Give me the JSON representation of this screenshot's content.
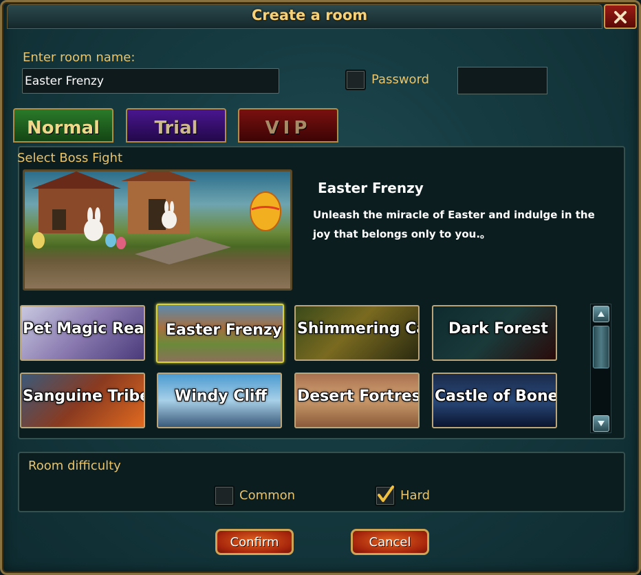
{
  "dialog": {
    "title": "Create a room",
    "close_icon": "close-icon"
  },
  "room": {
    "name_label": "Enter room name:",
    "name_value": "Easter Frenzy",
    "password_label": "Password",
    "password_checked": false,
    "password_value": ""
  },
  "tabs": [
    {
      "label": "Normal",
      "active": true
    },
    {
      "label": "Trial",
      "active": false
    },
    {
      "label": "VIP",
      "active": false
    }
  ],
  "boss": {
    "section_label": "Select Boss Fight",
    "selected_title": "Easter Frenzy",
    "selected_desc": "Unleash the miracle of Easter and indulge in the joy that belongs only to you.。",
    "options": [
      {
        "label": "Pet Magic Realm",
        "selected": false
      },
      {
        "label": "Easter Frenzy",
        "selected": true
      },
      {
        "label": "Shimmering Cave",
        "selected": false
      },
      {
        "label": "Dark Forest",
        "selected": false
      },
      {
        "label": "Sanguine Tribe",
        "selected": false
      },
      {
        "label": "Windy Cliff",
        "selected": false
      },
      {
        "label": "Desert Fortress",
        "selected": false
      },
      {
        "label": "Castle of Bones",
        "selected": false
      }
    ]
  },
  "difficulty": {
    "label": "Room difficulty",
    "common_label": "Common",
    "common_checked": false,
    "hard_label": "Hard",
    "hard_checked": true
  },
  "buttons": {
    "confirm": "Confirm",
    "cancel": "Cancel"
  },
  "colors": {
    "accent_gold": "#e9c46a",
    "panel_teal": "#1f4c52",
    "button_orange": "#c8451a"
  }
}
